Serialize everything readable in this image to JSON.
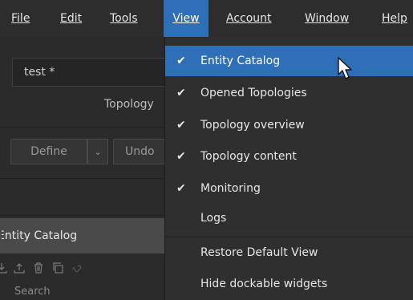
{
  "menubar": {
    "items": [
      {
        "label": "File",
        "active": false
      },
      {
        "label": "Edit",
        "active": false
      },
      {
        "label": "Tools",
        "active": false
      },
      {
        "label": "View",
        "active": true
      },
      {
        "label": "Account",
        "active": false
      },
      {
        "label": "Window",
        "active": false
      },
      {
        "label": "Help",
        "active": false
      }
    ]
  },
  "topology": {
    "name": "test *",
    "label": "Topology"
  },
  "buttons": {
    "define": "Define",
    "undo": "Undo"
  },
  "panel": {
    "section_title": "Entity Catalog",
    "search_placeholder": "Search"
  },
  "view_menu": {
    "items": [
      {
        "label": "Entity Catalog",
        "checked": true,
        "highlighted": true
      },
      {
        "label": "Opened Topologies",
        "checked": true
      },
      {
        "label": "Topology overview",
        "checked": true
      },
      {
        "label": "Topology content",
        "checked": true
      },
      {
        "label": "Monitoring",
        "checked": true
      },
      {
        "label": "Logs",
        "checked": false
      },
      {
        "label": "Restore Default View",
        "checked": false
      },
      {
        "label": "Hide dockable widgets",
        "checked": false
      }
    ],
    "check_glyph": "✔"
  },
  "colors": {
    "accent": "#2e6fb7",
    "bg": "#2b2b2b",
    "menu_bg": "#2f2f2f"
  }
}
